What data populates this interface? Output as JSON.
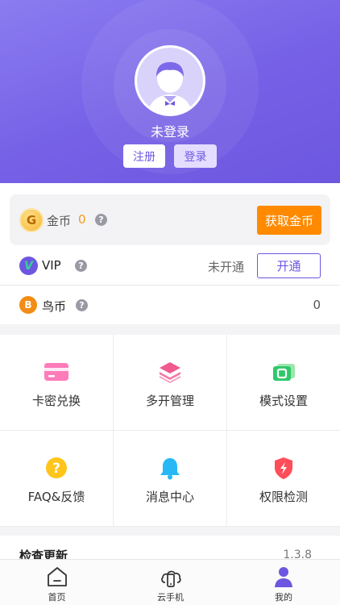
{
  "profile": {
    "username": "未登录",
    "register_label": "注册",
    "login_label": "登录"
  },
  "coins": {
    "icon_letter": "G",
    "label": "金币",
    "value": "0",
    "help": "?",
    "get_button": "获取金币"
  },
  "vip": {
    "icon_letter": "V",
    "label": "VIP",
    "help": "?",
    "status": "未开通",
    "open_button": "开通"
  },
  "bird": {
    "icon_letter": "B",
    "label": "鸟币",
    "help": "?",
    "value": "0"
  },
  "grid": {
    "items": [
      {
        "label": "卡密兑换",
        "icon": "card-icon"
      },
      {
        "label": "多开管理",
        "icon": "layers-icon"
      },
      {
        "label": "模式设置",
        "icon": "mode-icon"
      },
      {
        "label": "FAQ&反馈",
        "icon": "faq-icon"
      },
      {
        "label": "消息中心",
        "icon": "bell-icon"
      },
      {
        "label": "权限检测",
        "icon": "shield-icon"
      }
    ]
  },
  "update": {
    "label": "检查更新",
    "version": "1.3.8"
  },
  "tabs": [
    {
      "label": "首页",
      "icon": "home-icon"
    },
    {
      "label": "云手机",
      "icon": "cloud-phone-icon"
    },
    {
      "label": "我的",
      "icon": "user-icon"
    }
  ],
  "colors": {
    "accent": "#6c57e0",
    "orange": "#ff8a00",
    "coin_value": "#f39a1e"
  }
}
